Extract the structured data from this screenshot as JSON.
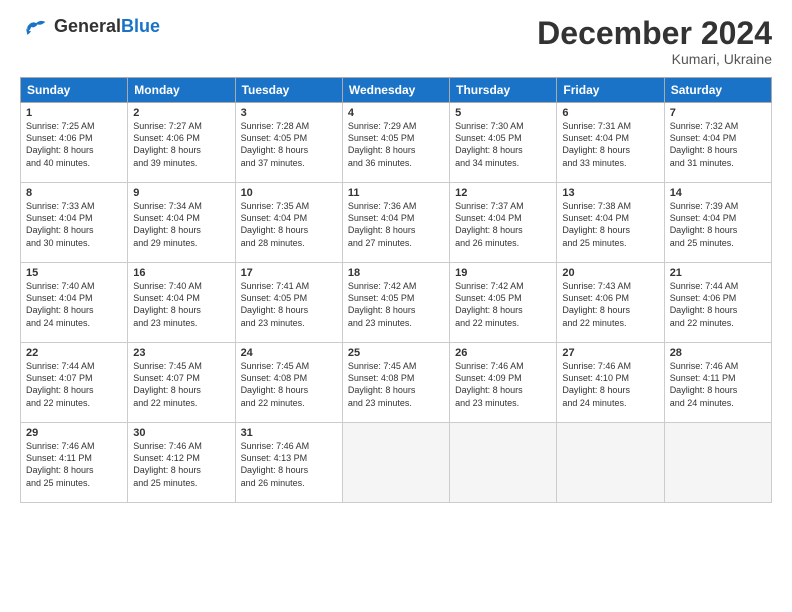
{
  "header": {
    "logo_line1": "General",
    "logo_line2": "Blue",
    "month": "December 2024",
    "location": "Kumari, Ukraine"
  },
  "weekdays": [
    "Sunday",
    "Monday",
    "Tuesday",
    "Wednesday",
    "Thursday",
    "Friday",
    "Saturday"
  ],
  "weeks": [
    [
      {
        "day": "1",
        "info": "Sunrise: 7:25 AM\nSunset: 4:06 PM\nDaylight: 8 hours\nand 40 minutes."
      },
      {
        "day": "2",
        "info": "Sunrise: 7:27 AM\nSunset: 4:06 PM\nDaylight: 8 hours\nand 39 minutes."
      },
      {
        "day": "3",
        "info": "Sunrise: 7:28 AM\nSunset: 4:05 PM\nDaylight: 8 hours\nand 37 minutes."
      },
      {
        "day": "4",
        "info": "Sunrise: 7:29 AM\nSunset: 4:05 PM\nDaylight: 8 hours\nand 36 minutes."
      },
      {
        "day": "5",
        "info": "Sunrise: 7:30 AM\nSunset: 4:05 PM\nDaylight: 8 hours\nand 34 minutes."
      },
      {
        "day": "6",
        "info": "Sunrise: 7:31 AM\nSunset: 4:04 PM\nDaylight: 8 hours\nand 33 minutes."
      },
      {
        "day": "7",
        "info": "Sunrise: 7:32 AM\nSunset: 4:04 PM\nDaylight: 8 hours\nand 31 minutes."
      }
    ],
    [
      {
        "day": "8",
        "info": "Sunrise: 7:33 AM\nSunset: 4:04 PM\nDaylight: 8 hours\nand 30 minutes."
      },
      {
        "day": "9",
        "info": "Sunrise: 7:34 AM\nSunset: 4:04 PM\nDaylight: 8 hours\nand 29 minutes."
      },
      {
        "day": "10",
        "info": "Sunrise: 7:35 AM\nSunset: 4:04 PM\nDaylight: 8 hours\nand 28 minutes."
      },
      {
        "day": "11",
        "info": "Sunrise: 7:36 AM\nSunset: 4:04 PM\nDaylight: 8 hours\nand 27 minutes."
      },
      {
        "day": "12",
        "info": "Sunrise: 7:37 AM\nSunset: 4:04 PM\nDaylight: 8 hours\nand 26 minutes."
      },
      {
        "day": "13",
        "info": "Sunrise: 7:38 AM\nSunset: 4:04 PM\nDaylight: 8 hours\nand 25 minutes."
      },
      {
        "day": "14",
        "info": "Sunrise: 7:39 AM\nSunset: 4:04 PM\nDaylight: 8 hours\nand 25 minutes."
      }
    ],
    [
      {
        "day": "15",
        "info": "Sunrise: 7:40 AM\nSunset: 4:04 PM\nDaylight: 8 hours\nand 24 minutes."
      },
      {
        "day": "16",
        "info": "Sunrise: 7:40 AM\nSunset: 4:04 PM\nDaylight: 8 hours\nand 23 minutes."
      },
      {
        "day": "17",
        "info": "Sunrise: 7:41 AM\nSunset: 4:05 PM\nDaylight: 8 hours\nand 23 minutes."
      },
      {
        "day": "18",
        "info": "Sunrise: 7:42 AM\nSunset: 4:05 PM\nDaylight: 8 hours\nand 23 minutes."
      },
      {
        "day": "19",
        "info": "Sunrise: 7:42 AM\nSunset: 4:05 PM\nDaylight: 8 hours\nand 22 minutes."
      },
      {
        "day": "20",
        "info": "Sunrise: 7:43 AM\nSunset: 4:06 PM\nDaylight: 8 hours\nand 22 minutes."
      },
      {
        "day": "21",
        "info": "Sunrise: 7:44 AM\nSunset: 4:06 PM\nDaylight: 8 hours\nand 22 minutes."
      }
    ],
    [
      {
        "day": "22",
        "info": "Sunrise: 7:44 AM\nSunset: 4:07 PM\nDaylight: 8 hours\nand 22 minutes."
      },
      {
        "day": "23",
        "info": "Sunrise: 7:45 AM\nSunset: 4:07 PM\nDaylight: 8 hours\nand 22 minutes."
      },
      {
        "day": "24",
        "info": "Sunrise: 7:45 AM\nSunset: 4:08 PM\nDaylight: 8 hours\nand 22 minutes."
      },
      {
        "day": "25",
        "info": "Sunrise: 7:45 AM\nSunset: 4:08 PM\nDaylight: 8 hours\nand 23 minutes."
      },
      {
        "day": "26",
        "info": "Sunrise: 7:46 AM\nSunset: 4:09 PM\nDaylight: 8 hours\nand 23 minutes."
      },
      {
        "day": "27",
        "info": "Sunrise: 7:46 AM\nSunset: 4:10 PM\nDaylight: 8 hours\nand 24 minutes."
      },
      {
        "day": "28",
        "info": "Sunrise: 7:46 AM\nSunset: 4:11 PM\nDaylight: 8 hours\nand 24 minutes."
      }
    ],
    [
      {
        "day": "29",
        "info": "Sunrise: 7:46 AM\nSunset: 4:11 PM\nDaylight: 8 hours\nand 25 minutes."
      },
      {
        "day": "30",
        "info": "Sunrise: 7:46 AM\nSunset: 4:12 PM\nDaylight: 8 hours\nand 25 minutes."
      },
      {
        "day": "31",
        "info": "Sunrise: 7:46 AM\nSunset: 4:13 PM\nDaylight: 8 hours\nand 26 minutes."
      },
      null,
      null,
      null,
      null
    ]
  ]
}
